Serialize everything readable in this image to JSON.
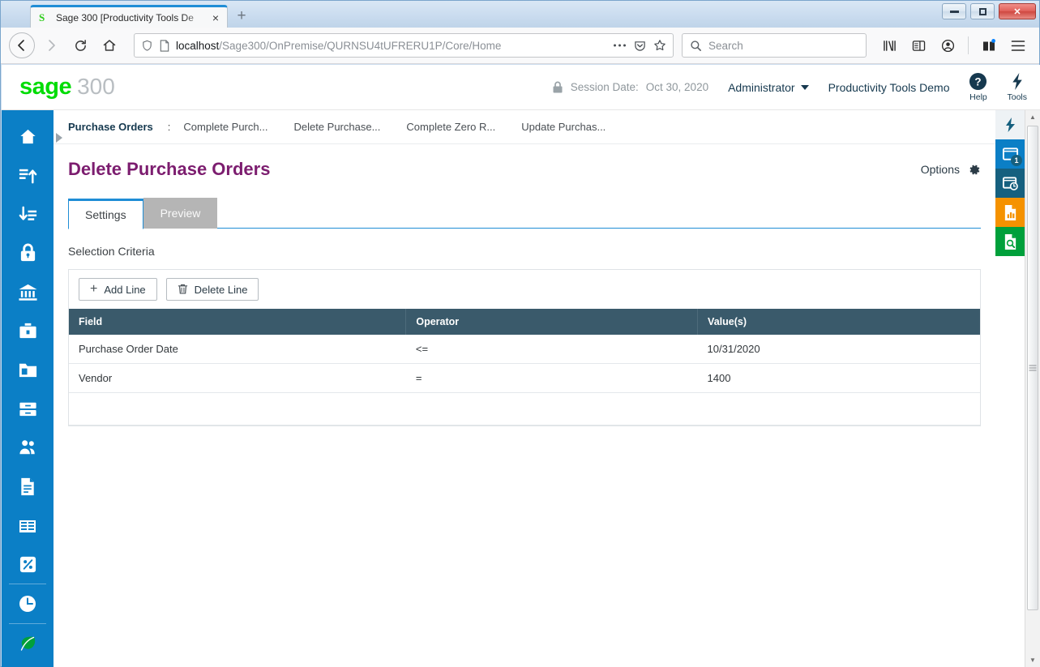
{
  "browser": {
    "tab": {
      "favicon": "S",
      "title": "Sage 300 [Productivity Tools De",
      "close": "×"
    },
    "newtab_label": "+",
    "window_controls": {
      "minimize": "minimize-icon",
      "maximize": "maximize-icon",
      "close": "✕"
    },
    "url": {
      "host": "localhost",
      "path": "/Sage300/OnPremise/QURNSU4tUFRERU1P/Core/Home"
    },
    "search_placeholder": "Search",
    "toolbar_icons": [
      "library-icon",
      "sidebar-icon",
      "account-icon",
      "extensions-gift-icon",
      "menu-icon"
    ]
  },
  "header": {
    "logo_brand": "sage",
    "logo_product": "300",
    "session_label": "Session Date:",
    "session_date": "Oct 30, 2020",
    "user": "Administrator",
    "company": "Productivity Tools Demo",
    "help_label": "Help",
    "tools_label": "Tools"
  },
  "breadcrumb": {
    "root": "Purchase Orders",
    "separator": ":",
    "items": [
      "Complete Purch...",
      "Delete Purchase...",
      "Complete Zero R...",
      "Update Purchas..."
    ]
  },
  "page": {
    "title": "Delete Purchase Orders",
    "options_label": "Options"
  },
  "tabs": [
    {
      "label": "Settings",
      "active": true
    },
    {
      "label": "Preview",
      "active": false
    }
  ],
  "section": {
    "label": "Selection Criteria"
  },
  "toolbar": {
    "add_line": "Add Line",
    "delete_line": "Delete Line"
  },
  "grid": {
    "columns": [
      "Field",
      "Operator",
      "Value(s)"
    ],
    "rows": [
      {
        "field": "Purchase Order Date",
        "operator": "<=",
        "value": "10/31/2020"
      },
      {
        "field": "Vendor",
        "operator": "=",
        "value": "1400"
      },
      {
        "field": "",
        "operator": "",
        "value": ""
      }
    ]
  },
  "left_rail": [
    "home-icon",
    "accounts-receivable-icon",
    "accounts-payable-icon",
    "lock-icon",
    "bank-icon",
    "briefcase-icon",
    "folder-icon",
    "inventory-drawer-icon",
    "people-icon",
    "document-icon",
    "grid-table-icon",
    "percent-icon",
    "clock-icon",
    "sage-leaf-icon"
  ],
  "right_rail": [
    {
      "name": "flash-icon",
      "badge": ""
    },
    {
      "name": "window-icon",
      "badge": "1"
    },
    {
      "name": "window-clock-icon",
      "badge": ""
    },
    {
      "name": "chart-document-icon",
      "badge": ""
    },
    {
      "name": "document-search-icon",
      "badge": ""
    }
  ],
  "colors": {
    "accent_blue": "#0b7fc6",
    "title_purple": "#7c1d6f",
    "grid_header": "#3a5a6b",
    "sage_green": "#00dc06",
    "orange": "#f59200",
    "green": "#00a03b"
  }
}
